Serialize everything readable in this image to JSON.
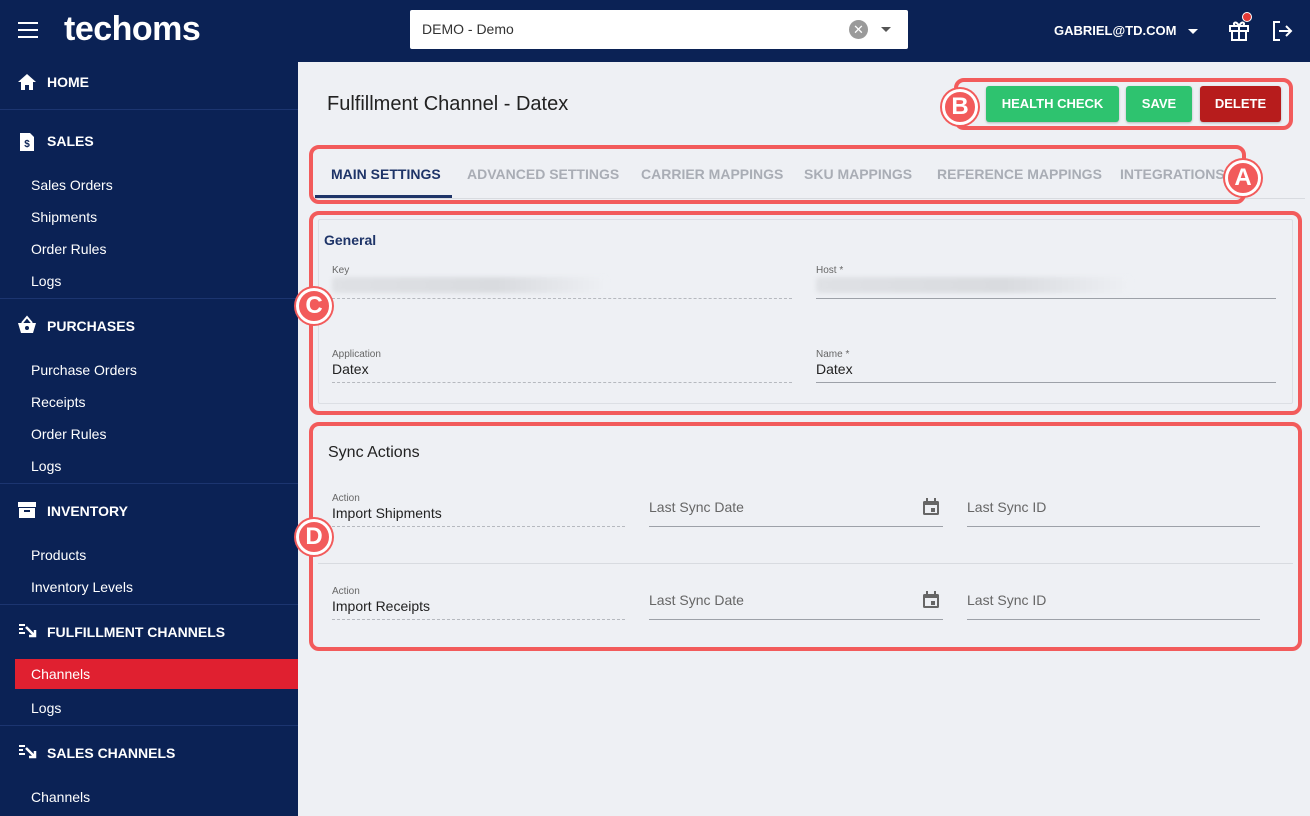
{
  "header": {
    "logo": "techoms",
    "org_select_value": "DEMO - Demo",
    "org_clear_glyph": "✕",
    "user_email": "GABRIEL@TD.COM",
    "icons": [
      "menu-icon",
      "gift-icon",
      "logout-icon"
    ]
  },
  "sidebar": {
    "sections": [
      {
        "label": "HOME",
        "icon": "home-icon",
        "items": []
      },
      {
        "label": "SALES",
        "icon": "dollar-doc-icon",
        "items": [
          "Sales Orders",
          "Shipments",
          "Order Rules",
          "Logs"
        ]
      },
      {
        "label": "PURCHASES",
        "icon": "basket-icon",
        "items": [
          "Purchase Orders",
          "Receipts",
          "Order Rules",
          "Logs"
        ]
      },
      {
        "label": "INVENTORY",
        "icon": "archive-icon",
        "items": [
          "Products",
          "Inventory Levels"
        ]
      },
      {
        "label": "FULFILLMENT CHANNELS",
        "icon": "channel-icon",
        "items": [
          "Channels",
          "Logs"
        ],
        "active_item": "Channels"
      },
      {
        "label": "SALES CHANNELS",
        "icon": "channel-icon",
        "items": [
          "Channels"
        ]
      }
    ]
  },
  "page": {
    "title": "Fulfillment Channel - Datex",
    "buttons": {
      "health_check": "HEALTH CHECK",
      "save": "SAVE",
      "delete": "DELETE"
    },
    "colors": {
      "primary_nav": "#0b2255",
      "success": "#2ec36f",
      "danger": "#b71c1c",
      "active_item": "#e02030",
      "annotation": "#f25b5b"
    },
    "tabs": [
      {
        "label": "MAIN SETTINGS",
        "active": true
      },
      {
        "label": "ADVANCED SETTINGS"
      },
      {
        "label": "CARRIER MAPPINGS"
      },
      {
        "label": "SKU MAPPINGS"
      },
      {
        "label": "REFERENCE MAPPINGS"
      },
      {
        "label": "INTEGRATIONS"
      }
    ]
  },
  "general": {
    "title": "General",
    "key_label": "Key",
    "host_label": "Host *",
    "application_label": "Application",
    "application_value": "Datex",
    "name_label": "Name *",
    "name_value": "Datex"
  },
  "sync": {
    "title": "Sync Actions",
    "rows": [
      {
        "action_label": "Action",
        "action_value": "Import Shipments",
        "date_placeholder": "Last Sync Date",
        "id_placeholder": "Last Sync ID"
      },
      {
        "action_label": "Action",
        "action_value": "Import Receipts",
        "date_placeholder": "Last Sync Date",
        "id_placeholder": "Last Sync ID"
      }
    ]
  },
  "annotations": {
    "a": "A",
    "b": "B",
    "c": "C",
    "d": "D"
  }
}
